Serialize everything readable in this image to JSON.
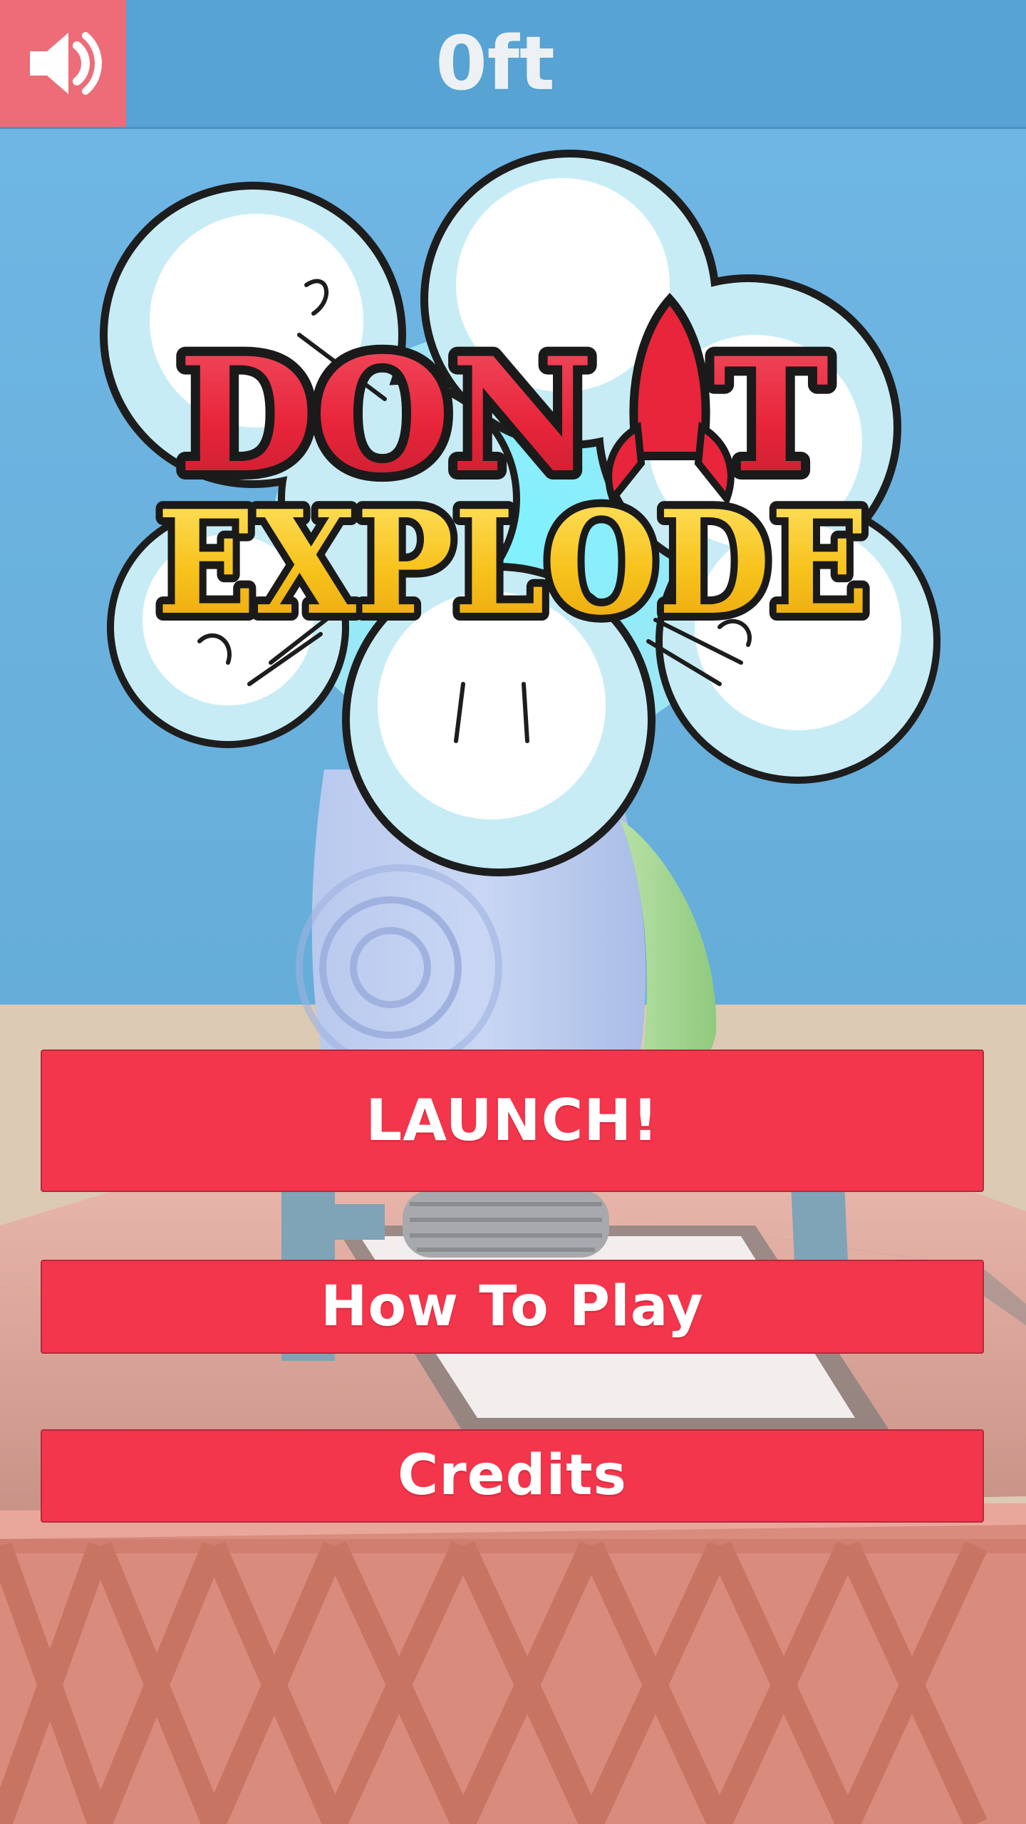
{
  "hud": {
    "distance": "0ft",
    "sound_icon": "speaker-volume-icon"
  },
  "logo": {
    "line1": "DON",
    "line1_end": "T",
    "line2": "EXPLODE",
    "rocket_icon": "rocket-icon",
    "title_colors": {
      "line1": "#e8253a",
      "line2": "#f7c21b"
    }
  },
  "menu": {
    "launch_label": "LAUNCH!",
    "how_to_play_label": "How To Play",
    "credits_label": "Credits"
  },
  "colors": {
    "sky": "#6db3e2",
    "topbar": "#56a3d4",
    "sound_button": "#ee6b78",
    "menu_button": "#f3364c",
    "ground": "#d9c8b4",
    "launch_pad": "#dc8f84"
  }
}
